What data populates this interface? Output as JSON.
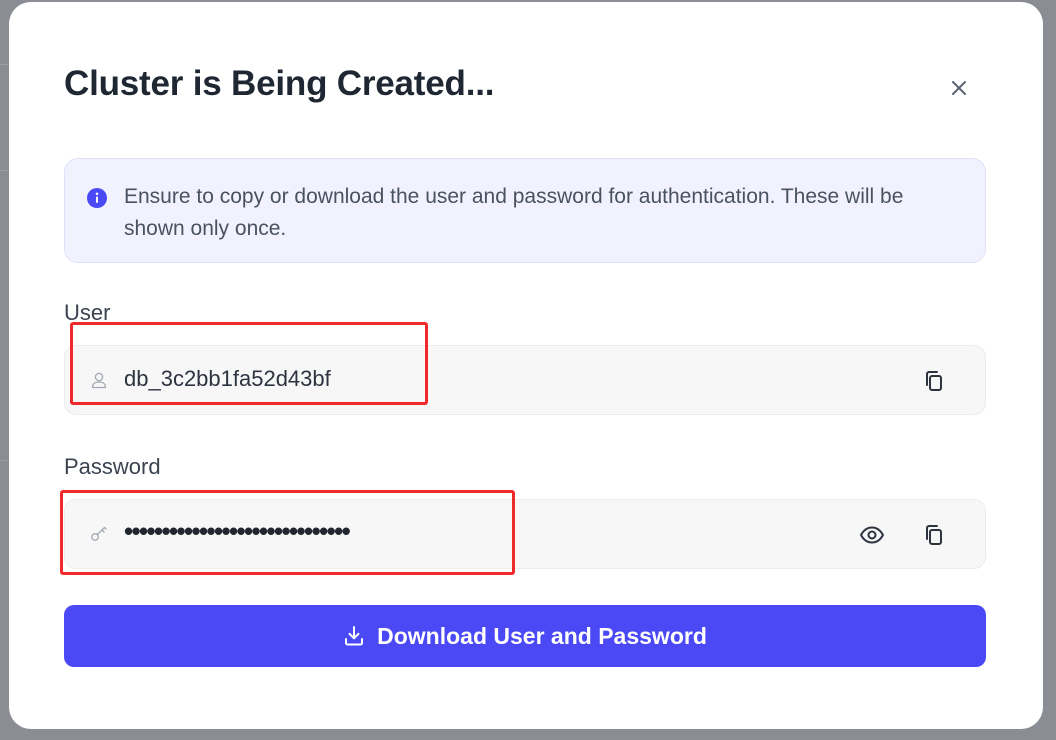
{
  "modal": {
    "title": "Cluster is Being Created...",
    "close_icon": "close-icon"
  },
  "notice": {
    "icon": "info-icon",
    "text": "Ensure to copy or download the user and password for authentication. These will be shown only once.",
    "accent_color": "#4a49f5"
  },
  "user_field": {
    "label": "User",
    "icon": "user-icon",
    "value": "db_3c2bb1fa52d43bf",
    "copy_icon": "copy-icon"
  },
  "password_field": {
    "label": "Password",
    "icon": "key-icon",
    "masked_value": "••••••••••••••••••••••••••••••",
    "reveal_icon": "eye-icon",
    "copy_icon": "copy-icon"
  },
  "download": {
    "label": "Download User and Password",
    "icon": "download-icon",
    "color": "#4a49f5"
  },
  "annotation": {
    "color": "#ee2a2a"
  }
}
